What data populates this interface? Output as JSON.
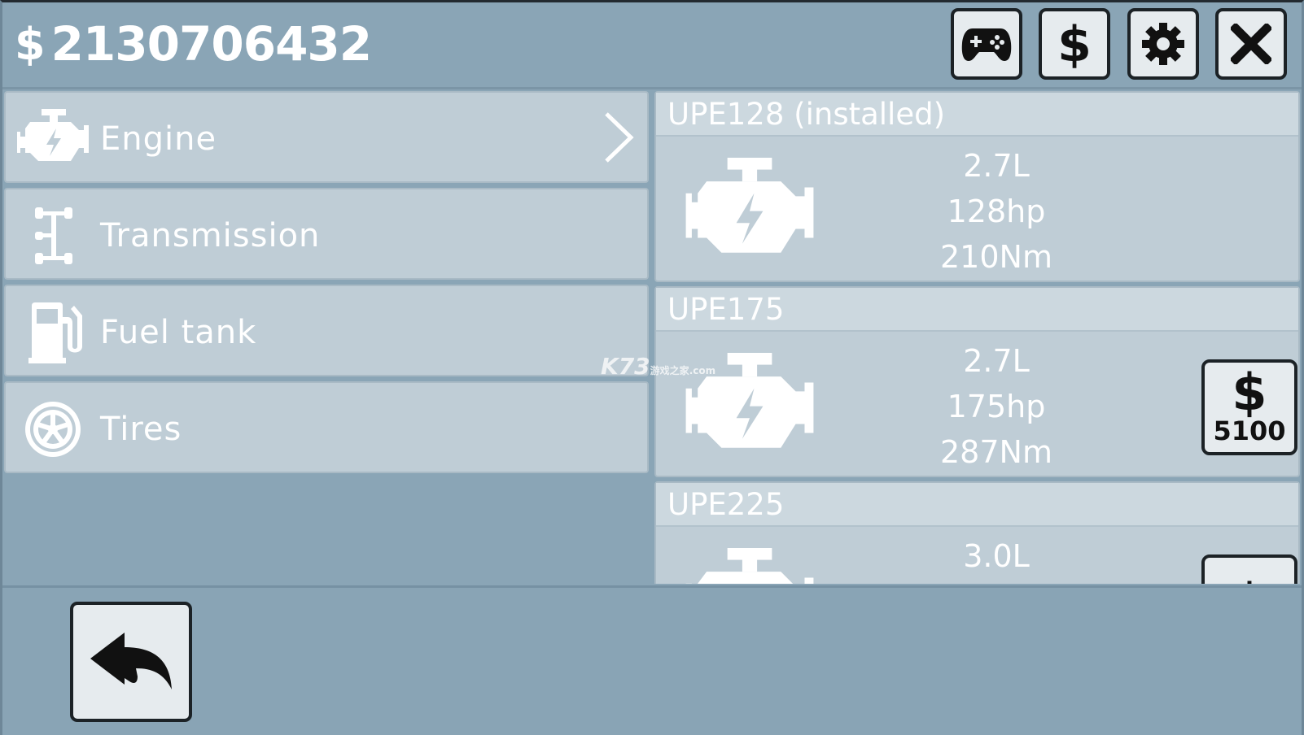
{
  "header": {
    "currency_symbol": "$",
    "balance": "2130706432",
    "buttons": [
      {
        "icon": "gamepad-icon"
      },
      {
        "icon": "dollar-icon"
      },
      {
        "icon": "gear-icon"
      },
      {
        "icon": "close-icon"
      }
    ]
  },
  "categories": [
    {
      "label": "Engine",
      "icon": "engine-icon",
      "selected": true
    },
    {
      "label": "Transmission",
      "icon": "transmission-icon"
    },
    {
      "label": "Fuel tank",
      "icon": "fuel-pump-icon"
    },
    {
      "label": "Tires",
      "icon": "tire-icon"
    }
  ],
  "parts": [
    {
      "name": "UPE128 (installed)",
      "displacement": "2.7L",
      "power": "128hp",
      "torque": "210Nm"
    },
    {
      "name": "UPE175",
      "displacement": "2.7L",
      "power": "175hp",
      "torque": "287Nm",
      "buy_symbol": "$",
      "price": "5100"
    },
    {
      "name": "UPE225",
      "displacement": "3.0L",
      "buy_symbol": "$"
    }
  ],
  "watermark": {
    "text": "K73",
    "sub": "游戏之家",
    "domain": ".com"
  },
  "footer": {
    "back_icon": "back-arrow-icon"
  }
}
